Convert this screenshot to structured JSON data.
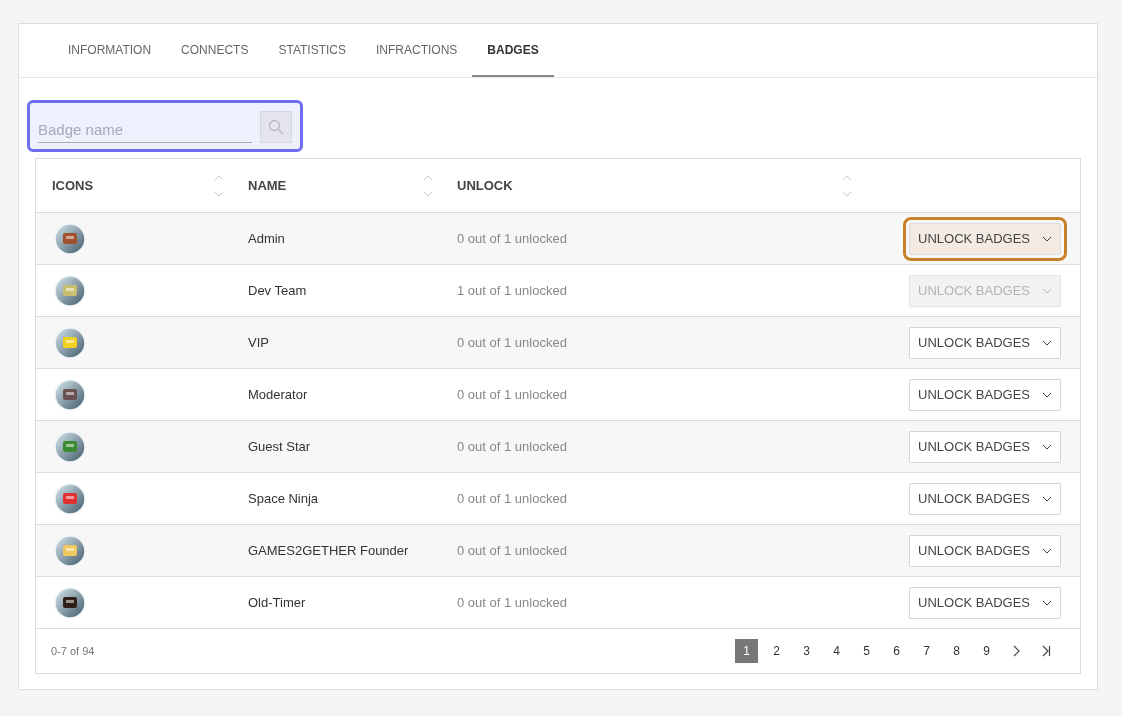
{
  "tabs": [
    {
      "label": "INFORMATION",
      "selected": false
    },
    {
      "label": "CONNECTS",
      "selected": false
    },
    {
      "label": "STATISTICS",
      "selected": false
    },
    {
      "label": "INFRACTIONS",
      "selected": false
    },
    {
      "label": "BADGES",
      "selected": true
    }
  ],
  "search": {
    "placeholder": "Badge name",
    "focused": true
  },
  "table": {
    "columns": [
      {
        "label": "ICONS"
      },
      {
        "label": "NAME"
      },
      {
        "label": "UNLOCK"
      }
    ],
    "rows": [
      {
        "name": "Admin",
        "unlock": "0 out of 1 unlocked",
        "button": "UNLOCK BADGES",
        "disabled": false,
        "focused": true
      },
      {
        "name": "Dev Team",
        "unlock": "1 out of 1 unlocked",
        "button": "UNLOCK BADGES",
        "disabled": true,
        "focused": false
      },
      {
        "name": "VIP",
        "unlock": "0 out of 1 unlocked",
        "button": "UNLOCK BADGES",
        "disabled": false,
        "focused": false
      },
      {
        "name": "Moderator",
        "unlock": "0 out of 1 unlocked",
        "button": "UNLOCK BADGES",
        "disabled": false,
        "focused": false
      },
      {
        "name": "Guest Star",
        "unlock": "0 out of 1 unlocked",
        "button": "UNLOCK BADGES",
        "disabled": false,
        "focused": false
      },
      {
        "name": "Space Ninja",
        "unlock": "0 out of 1 unlocked",
        "button": "UNLOCK BADGES",
        "disabled": false,
        "focused": false
      },
      {
        "name": "GAMES2GETHER Founder",
        "unlock": "0 out of 1 unlocked",
        "button": "UNLOCK BADGES",
        "disabled": false,
        "focused": false
      },
      {
        "name": "Old-Timer",
        "unlock": "0 out of 1 unlocked",
        "button": "UNLOCK BADGES",
        "disabled": false,
        "focused": false
      }
    ]
  },
  "pagination": {
    "range": "0-7 of 94",
    "pages": [
      {
        "label": "1",
        "selected": true
      },
      {
        "label": "2",
        "selected": false
      },
      {
        "label": "3",
        "selected": false
      },
      {
        "label": "4",
        "selected": false
      },
      {
        "label": "5",
        "selected": false
      },
      {
        "label": "6",
        "selected": false
      },
      {
        "label": "7",
        "selected": false
      },
      {
        "label": "8",
        "selected": false
      },
      {
        "label": "9",
        "selected": false
      }
    ]
  }
}
